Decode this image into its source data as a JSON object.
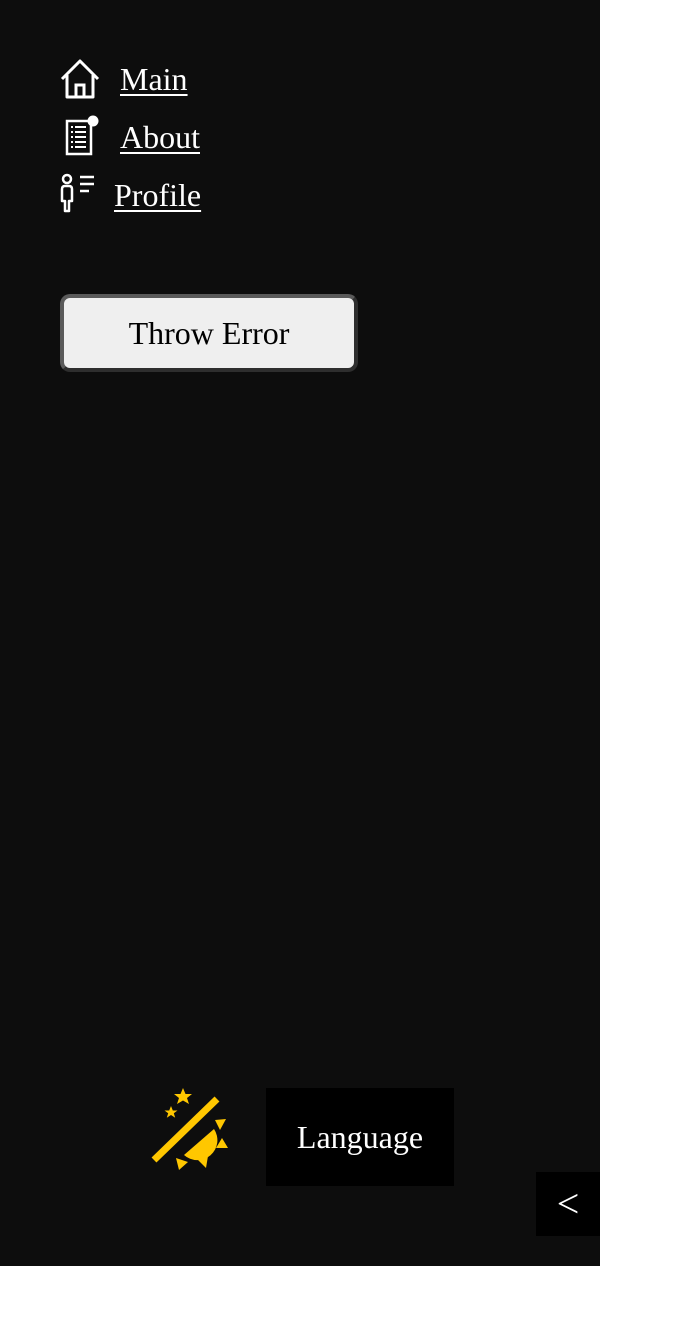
{
  "nav": {
    "items": [
      {
        "label": "Main",
        "icon": "home-icon"
      },
      {
        "label": "About",
        "icon": "document-list-icon"
      },
      {
        "label": "Profile",
        "icon": "person-list-icon"
      }
    ]
  },
  "actions": {
    "throw_error_label": "Throw Error"
  },
  "footer": {
    "theme_toggle_icon": "theme-toggle-icon",
    "language_label": "Language",
    "collapse_label": "<"
  },
  "colors": {
    "sidebar_bg": "#0d0d0d",
    "accent": "#ffc700",
    "text": "#ffffff",
    "button_bg": "#efefef"
  }
}
